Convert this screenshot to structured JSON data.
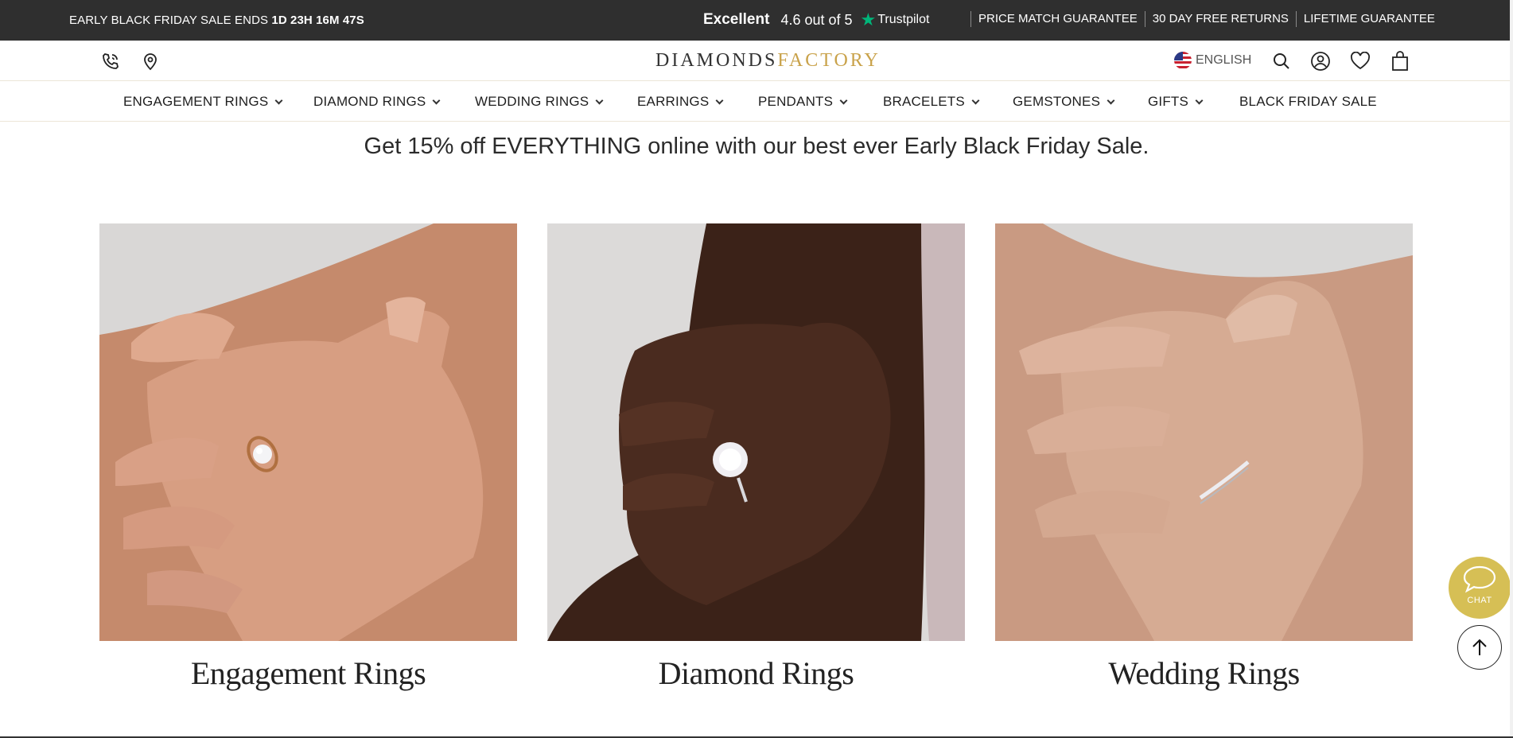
{
  "promo": {
    "sale_text": "EARLY BLACK FRIDAY SALE ENDS ",
    "countdown": "1D 23H 16M 47S",
    "rating_word": "Excellent",
    "rating_score": "4.6 out of 5",
    "star_icon": "★",
    "trustpilot": "Trustpilot",
    "guarantees": [
      "PRICE MATCH GUARANTEE",
      "30 DAY FREE RETURNS",
      "LIFETIME GUARANTEE"
    ]
  },
  "header": {
    "logo_part1": "DIAMONDS",
    "logo_part2": "FACTORY",
    "language": "ENGLISH",
    "icons": [
      "phone-icon",
      "location-pin-icon",
      "search-icon",
      "account-icon",
      "wishlist-heart-icon",
      "shopping-bag-icon"
    ]
  },
  "nav": {
    "items": [
      {
        "label": "ENGAGEMENT RINGS",
        "dropdown": true
      },
      {
        "label": "DIAMOND RINGS",
        "dropdown": true
      },
      {
        "label": "WEDDING RINGS",
        "dropdown": true
      },
      {
        "label": "EARRINGS",
        "dropdown": true
      },
      {
        "label": "PENDANTS",
        "dropdown": true
      },
      {
        "label": "BRACELETS",
        "dropdown": true
      },
      {
        "label": "GEMSTONES",
        "dropdown": true
      },
      {
        "label": "GIFTS",
        "dropdown": true
      },
      {
        "label": "BLACK FRIDAY SALE",
        "dropdown": false
      }
    ]
  },
  "tagline": "Get 15% off EVERYTHING online with our best ever Early Black Friday Sale.",
  "categories": [
    {
      "title": "Engagement Rings"
    },
    {
      "title": "Diamond Rings"
    },
    {
      "title": "Wedding Rings"
    }
  ],
  "widgets": {
    "chat_label": "CHAT"
  },
  "colors": {
    "promo_bg": "#2f2f2f",
    "brand_gold": "#c9a24a",
    "trustpilot_green": "#00b67a",
    "chat_bg": "#d6bf55"
  }
}
